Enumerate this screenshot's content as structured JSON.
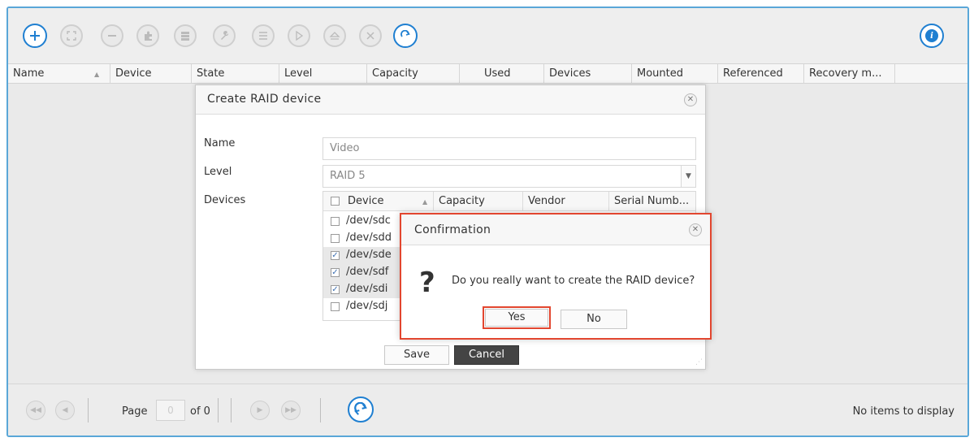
{
  "toolbar": {
    "buttons": [
      "add-icon",
      "expand-icon",
      "remove-icon",
      "puzzle-icon",
      "disk-icon",
      "wrench-icon",
      "list-icon",
      "play-icon",
      "eject-icon",
      "close-icon",
      "refresh-icon"
    ],
    "info": "info-icon"
  },
  "grid": {
    "columns": [
      "Name",
      "Device",
      "State",
      "Level",
      "Capacity",
      "Used",
      "Devices",
      "Mounted",
      "Referenced",
      "Recovery m..."
    ]
  },
  "footer": {
    "page_label": "Page",
    "page_value": "0",
    "of_label": "of 0",
    "status": "No items to display"
  },
  "dialog": {
    "title": "Create RAID device",
    "name_label": "Name",
    "name_value": "Video",
    "level_label": "Level",
    "level_value": "RAID 5",
    "devices_label": "Devices",
    "table_columns": [
      "Device",
      "Capacity",
      "Vendor",
      "Serial Numb..."
    ],
    "devices": [
      {
        "name": "/dev/sdc",
        "checked": false
      },
      {
        "name": "/dev/sdd",
        "checked": false
      },
      {
        "name": "/dev/sde",
        "checked": true
      },
      {
        "name": "/dev/sdf",
        "checked": true
      },
      {
        "name": "/dev/sdi",
        "checked": true
      },
      {
        "name": "/dev/sdj",
        "checked": false
      }
    ],
    "save_label": "Save",
    "cancel_label": "Cancel"
  },
  "confirmation": {
    "title": "Confirmation",
    "icon": "question-icon",
    "message": "Do you really want to create the RAID device?",
    "yes_label": "Yes",
    "no_label": "No"
  },
  "colors": {
    "accent": "#1f7fd1",
    "highlight": "#e2462f"
  }
}
